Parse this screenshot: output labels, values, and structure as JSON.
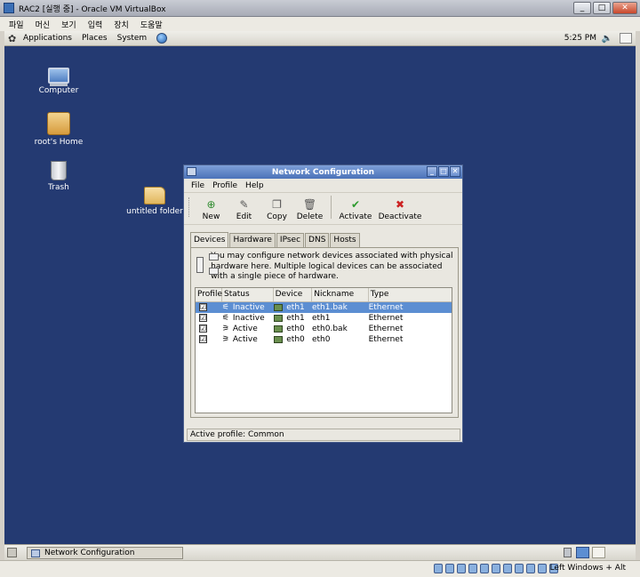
{
  "host": {
    "title": "RAC2 [실행 중] - Oracle VM VirtualBox",
    "menu": [
      "파일",
      "머신",
      "보기",
      "입력",
      "장치",
      "도움말"
    ],
    "host_key": "Left Windows + Alt"
  },
  "panel": {
    "menus": [
      "Applications",
      "Places",
      "System"
    ],
    "clock": "5:25 PM",
    "volume_icon": "speaker-icon"
  },
  "desktop": {
    "icons": [
      "Computer",
      "root's Home",
      "Trash",
      "untitled folder"
    ]
  },
  "window": {
    "title": "Network Configuration",
    "menu": [
      "File",
      "Profile",
      "Help"
    ],
    "toolbar": {
      "new": "New",
      "edit": "Edit",
      "copy": "Copy",
      "delete": "Delete",
      "activate": "Activate",
      "deactivate": "Deactivate"
    },
    "tabs": [
      "Devices",
      "Hardware",
      "IPsec",
      "DNS",
      "Hosts"
    ],
    "info": "You may configure network devices associated with physical hardware here.  Multiple logical devices can be associated with a single piece of hardware.",
    "columns": [
      "Profile",
      "Status",
      "Device",
      "Nickname",
      "Type"
    ],
    "rows": [
      {
        "checked": "☑",
        "status": "Inactive",
        "device": "eth1",
        "nickname": "eth1.bak",
        "type": "Ethernet"
      },
      {
        "checked": "☑",
        "status": "Inactive",
        "device": "eth1",
        "nickname": "eth1",
        "type": "Ethernet"
      },
      {
        "checked": "☑",
        "status": "Active",
        "device": "eth0",
        "nickname": "eth0.bak",
        "type": "Ethernet"
      },
      {
        "checked": "☑",
        "status": "Active",
        "device": "eth0",
        "nickname": "eth0",
        "type": "Ethernet"
      }
    ],
    "status": "Active profile: Common"
  },
  "taskbar": {
    "task": "Network Configuration"
  },
  "colors": {
    "desktop": "#243a72",
    "selection": "#5c8ed2",
    "titlebar": "#4b72b9"
  }
}
